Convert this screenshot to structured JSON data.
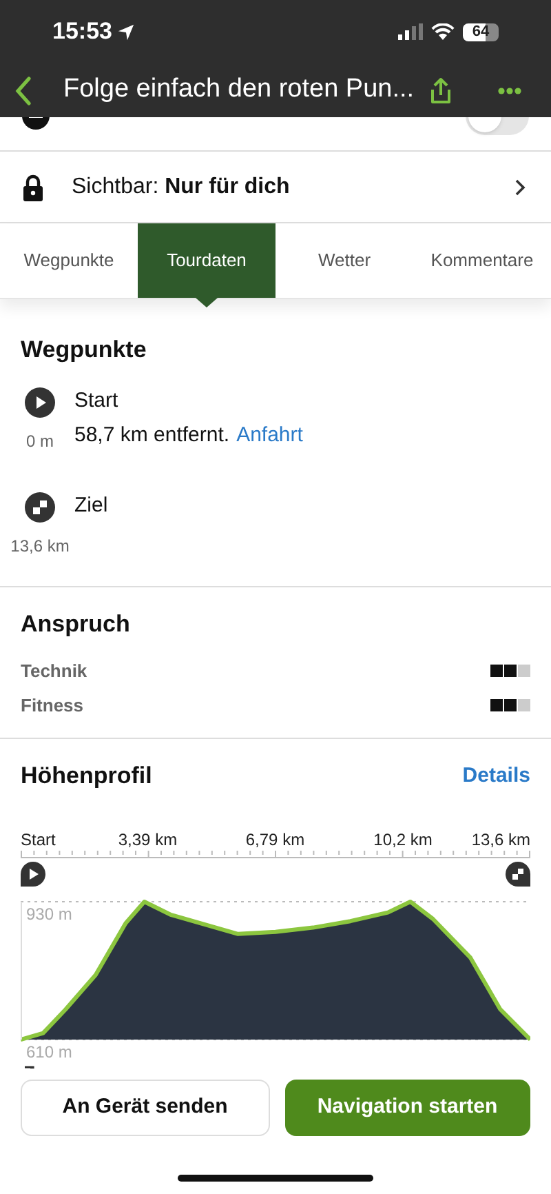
{
  "status_bar": {
    "time": "15:53",
    "battery": "64"
  },
  "header": {
    "title": "Folge einfach den roten Pun..."
  },
  "settings": [
    {
      "kind": "toggle",
      "on": false
    },
    {
      "kind": "link",
      "label": "Sichtbar: **Nur für dich**"
    }
  ],
  "tabs": [
    {
      "label": "Wegpunkte",
      "selected": false
    },
    {
      "label": "Tourdaten",
      "selected": true
    },
    {
      "label": "Wetter",
      "selected": false
    },
    {
      "label": "Kommentare",
      "selected": false
    }
  ],
  "waypoints": {
    "title": "Wegpunkte",
    "items": [
      {
        "kind": "start",
        "name": "Start",
        "distance": "0 m",
        "detail": "58,7 km entfernt.",
        "link": "Anfahrt"
      },
      {
        "kind": "finish",
        "name": "Ziel",
        "distance": "13,6 km"
      }
    ]
  },
  "difficulty": {
    "title": "Anspruch",
    "items": [
      {
        "label": "Technik",
        "stars": 2
      },
      {
        "label": "Fitness",
        "stars": 2
      }
    ]
  },
  "elevation": {
    "title": "Höhenprofil",
    "link": "Details",
    "chart_data": {
      "type": "area",
      "x": [
        0,
        0.6,
        1.2,
        2,
        2.8,
        3.3,
        4,
        5,
        5.8,
        6.8,
        7.8,
        8.8,
        9.8,
        10.4,
        11,
        12,
        12.8,
        13.6
      ],
      "series": [
        {
          "color": "#2b3442",
          "values": [
            610,
            625,
            680,
            760,
            880,
            930,
            900,
            875,
            855,
            860,
            870,
            885,
            905,
            930,
            890,
            800,
            680,
            610
          ]
        }
      ],
      "xlim": [
        0,
        13.6
      ],
      "ylim": [
        610,
        930
      ],
      "yticks": [
        {
          "value": 930,
          "label": "930 m"
        },
        {
          "value": 610,
          "label": "610 m"
        }
      ],
      "xticks": [
        {
          "value": 0,
          "label": "Start"
        },
        {
          "value": 3.39,
          "label": "3,39 km"
        },
        {
          "value": 6.79,
          "label": "6,79 km"
        },
        {
          "value": 10.2,
          "label": "10,2 km"
        },
        {
          "value": 13.6,
          "label": "13,6 km"
        }
      ]
    }
  },
  "actions": [
    {
      "kind": "secondary",
      "label": "An Gerät senden"
    },
    {
      "kind": "primary",
      "label": "Navigation starten"
    }
  ]
}
